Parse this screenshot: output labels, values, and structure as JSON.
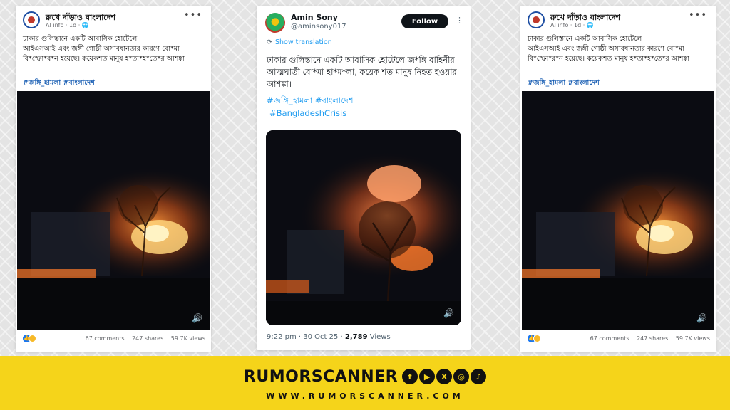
{
  "fb_left": {
    "page_name": "রুখে দাঁড়াও বাংলাদেশ",
    "meta": "AI info · 1d · 🌐",
    "text_line1": "ঢাকার গুলিস্তানে একটি আবাসিক হোটেলে",
    "text_line2": " আইএসআই এবং জঙ্গী গোষ্ঠী অসাবধানতার কারণে বো*মা",
    "text_line3": "বি*স্ফো*র*ন হয়েছে। কয়েকশত মানুষ হ*তা*হ*তে*র আশঙ্কা",
    "hashtags": "#জঙ্গি_হামলা #বাংলাদেশ",
    "comments": "67 comments",
    "shares": "247 shares",
    "views": "59.7K views"
  },
  "fb_right": {
    "page_name": "রুখে দাঁড়াও বাংলাদেশ",
    "meta": "AI info · 1d · 🌐",
    "text_line1": "ঢাকার গুলিস্তানে একটি আবাসিক হোটেলে",
    "text_line2": " আইএসআই এবং জঙ্গী গোষ্ঠী অসাবধানতার কারণে বো*মা",
    "text_line3": "বি*স্ফো*র*ন হয়েছে। কয়েকশত মানুষ হ*তা*হ*তে*র আশঙ্কা",
    "hashtags": "#জঙ্গি_হামলা #বাংলাদেশ",
    "comments": "67 comments",
    "shares": "247 shares",
    "views": "59.7K views"
  },
  "x_post": {
    "name": "Amin Sony",
    "handle": "@aminsony017",
    "follow_label": "Follow",
    "show_translation": "Show translation",
    "text": "ঢাকার গুলিস্তানে একটি আবাসিক হোটেলে জ*ঙ্গি বাহিনীর আত্মঘাতী বো*মা হা*ম*লা, কয়েক শত মানুষ নিহত হওয়ার আশঙ্কা।",
    "tag1": "#জঙ্গি_হামলা #বাংলাদেশ",
    "tag2": "#BangladeshCrisis",
    "time": "9:22 pm · 30 Oct 25 · ",
    "views_count": "2,789",
    "views_label": " Views"
  },
  "branding": {
    "name": "RUMORSCANNER",
    "url": "WWW.RUMORSCANNER.COM",
    "social_icons": [
      "facebook-icon",
      "youtube-icon",
      "x-icon",
      "instagram-icon",
      "tiktok-icon"
    ]
  },
  "colors": {
    "band": "#f5d41a",
    "link_blue": "#1d9bf0",
    "fb_blue": "#1a5fb4"
  }
}
